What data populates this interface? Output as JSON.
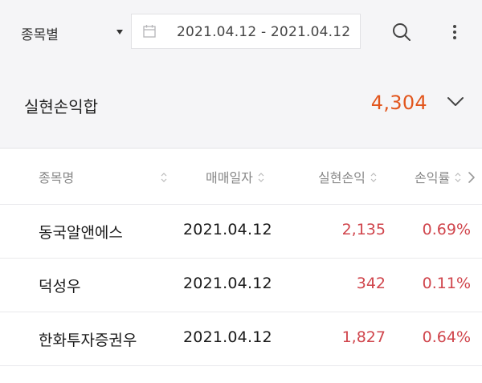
{
  "filter": {
    "category_label": "종목별",
    "date_start": "2021.04.12",
    "date_separator": "-",
    "date_end": "2021.04.12",
    "icons": [
      "calendar-icon",
      "search-icon",
      "more-vertical-icon"
    ]
  },
  "summary": {
    "title": "실현손익합",
    "total": "4,304",
    "total_color": "#e2561d"
  },
  "table": {
    "headers": [
      "종목명",
      "매매일자",
      "실현손익",
      "손익률"
    ],
    "rows": [
      {
        "name": "동국알앤에스",
        "date": "2021.04.12",
        "pl": "2,135",
        "rate": "0.69%"
      },
      {
        "name": "덕성우",
        "date": "2021.04.12",
        "pl": "342",
        "rate": "0.11%"
      },
      {
        "name": "한화투자증권우",
        "date": "2021.04.12",
        "pl": "1,827",
        "rate": "0.64%"
      }
    ],
    "positive_color": "#d0454c"
  }
}
